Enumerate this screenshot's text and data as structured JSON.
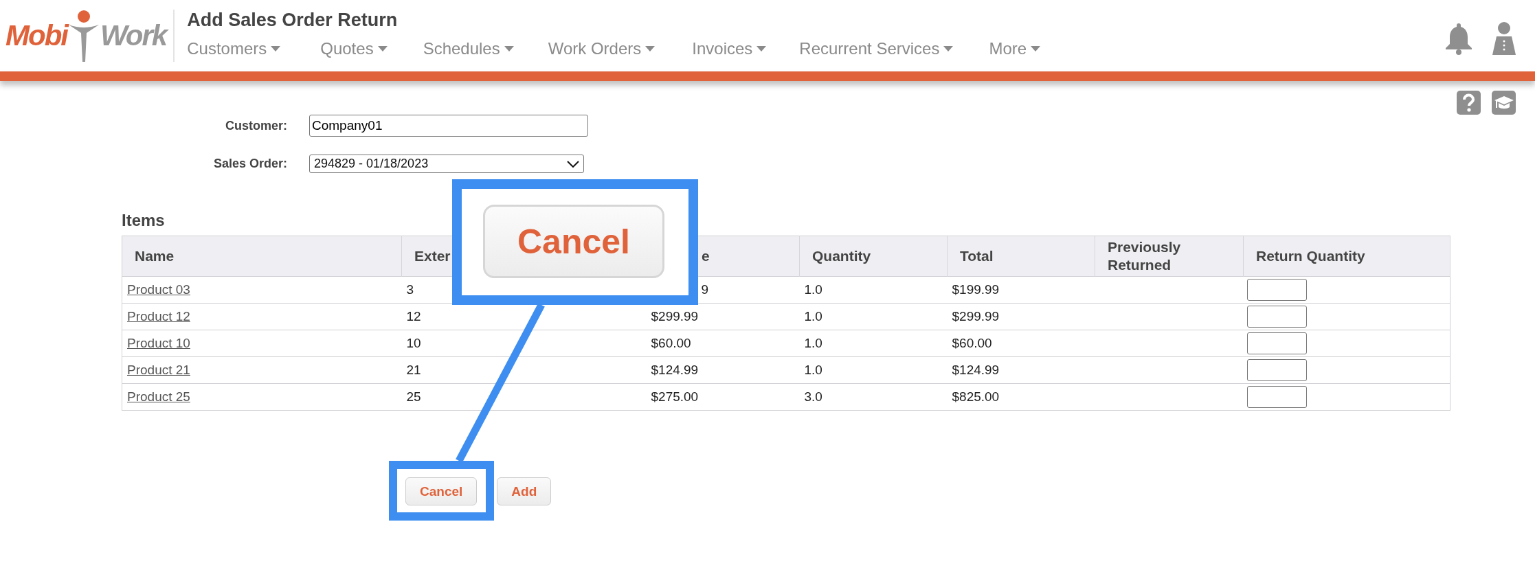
{
  "header": {
    "logo": {
      "part_1": "Mobi",
      "part_2": "Work"
    },
    "title": "Add Sales Order Return",
    "nav": [
      {
        "label": "Customers"
      },
      {
        "label": "Quotes"
      },
      {
        "label": "Schedules"
      },
      {
        "label": "Work Orders"
      },
      {
        "label": "Invoices"
      },
      {
        "label": "Recurrent Services"
      },
      {
        "label": "More"
      }
    ]
  },
  "form": {
    "fields": [
      {
        "kind": "text",
        "label": "Customer:",
        "value": "Company01"
      },
      {
        "kind": "select",
        "label": "Sales Order:",
        "value": "294829 - 01/18/2023"
      }
    ]
  },
  "items": {
    "title": "Items",
    "columns": [
      {
        "text": "Name"
      },
      {
        "text": "Exter"
      },
      {
        "text": "e",
        "covered": true
      },
      {
        "text": "Quantity"
      },
      {
        "text": "Total"
      },
      {
        "text": "Previously Returned"
      },
      {
        "text": "Return Quantity"
      }
    ],
    "rows": [
      {
        "name": "Product 03",
        "column_2": "3",
        "column_3": {
          "text": "9",
          "covered": true
        },
        "quantity": "1.0",
        "total": "$199.99"
      },
      {
        "name": "Product 12",
        "column_2": "12",
        "column_3": {
          "text": "$299.99",
          "covered": false
        },
        "quantity": "1.0",
        "total": "$299.99"
      },
      {
        "name": "Product 10",
        "column_2": "10",
        "column_3": {
          "text": "$60.00",
          "covered": false
        },
        "quantity": "1.0",
        "total": "$60.00"
      },
      {
        "name": "Product 21",
        "column_2": "21",
        "column_3": {
          "text": "$124.99",
          "covered": false
        },
        "quantity": "1.0",
        "total": "$124.99"
      },
      {
        "name": "Product 25",
        "column_2": "25",
        "column_3": {
          "text": "$275.00",
          "covered": false
        },
        "quantity": "3.0",
        "total": "$825.00"
      }
    ]
  },
  "buttons": [
    {
      "label": "Cancel"
    },
    {
      "label": "Add"
    }
  ],
  "callout": {
    "label": "Cancel"
  }
}
